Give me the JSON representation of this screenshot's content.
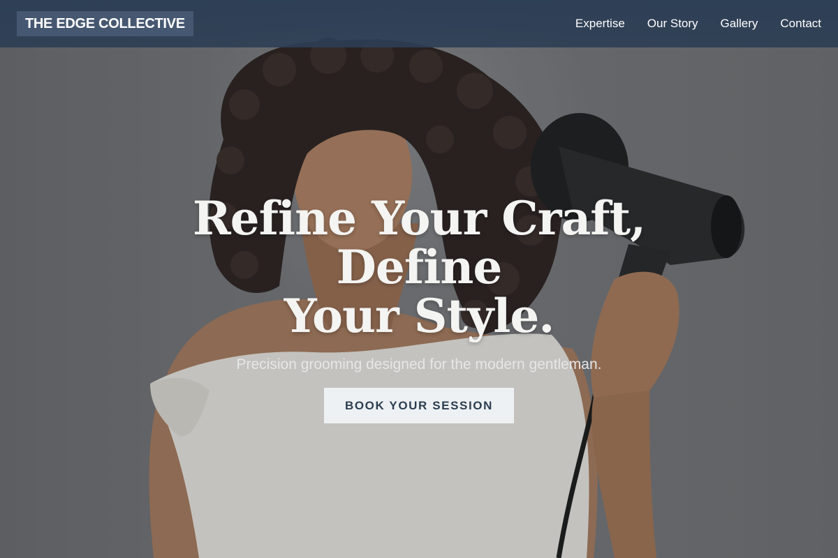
{
  "brand": {
    "name": "THE EDGE COLLECTIVE"
  },
  "nav": {
    "items": [
      {
        "label": "Expertise"
      },
      {
        "label": "Our Story"
      },
      {
        "label": "Gallery"
      },
      {
        "label": "Contact"
      }
    ]
  },
  "hero": {
    "title_line1": "Refine Your Craft, Define",
    "title_line2": "Your Style.",
    "subtitle": "Precision grooming designed for the modern gentleman.",
    "cta_label": "BOOK YOUR SESSION",
    "image_icon": "woman-with-hair-dryer-photo"
  },
  "colors": {
    "nav_background": "#2c3e50",
    "brand_background": "#4a5d75",
    "cta_background": "#eef1f3",
    "cta_text": "#2c3e50",
    "title_text": "#f4f4f2"
  }
}
